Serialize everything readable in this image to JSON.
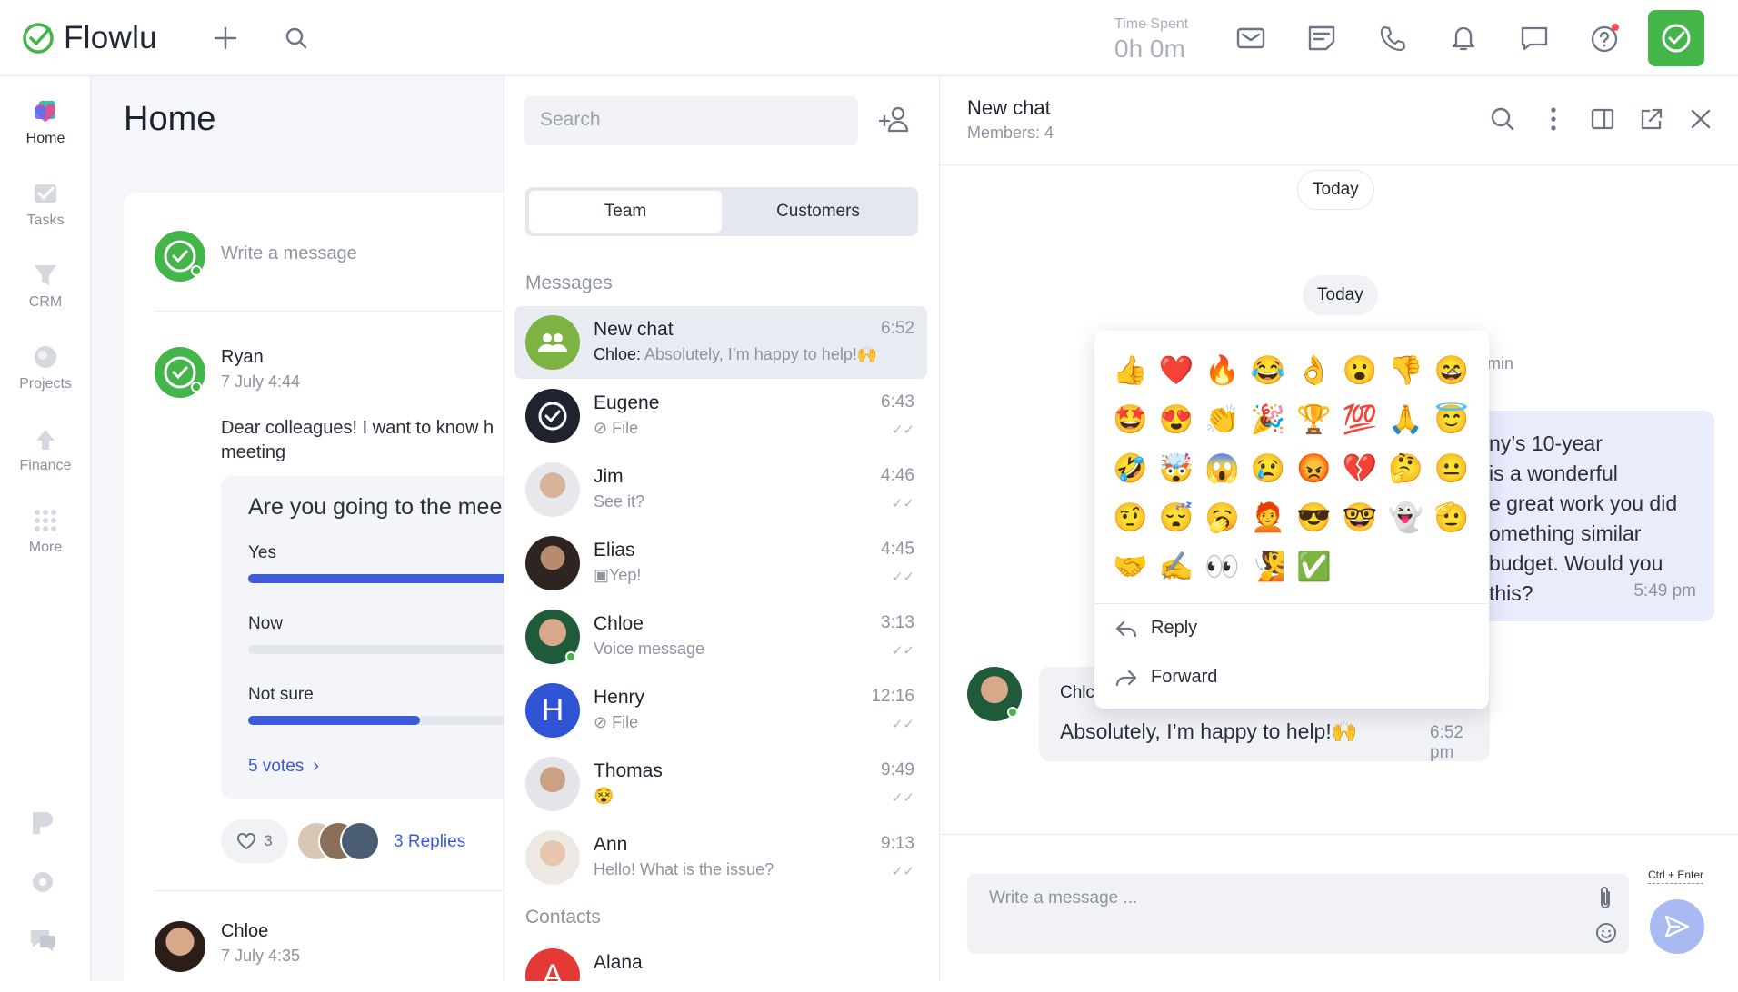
{
  "app": {
    "name": "Flowlu"
  },
  "topbar": {
    "time_label": "Time Spent",
    "time_value": "0h 0m"
  },
  "rail": {
    "items": [
      {
        "label": "Home",
        "icon": "home-icon"
      },
      {
        "label": "Tasks",
        "icon": "tasks-icon"
      },
      {
        "label": "CRM",
        "icon": "crm-icon"
      },
      {
        "label": "Projects",
        "icon": "projects-icon"
      },
      {
        "label": "Finance",
        "icon": "finance-icon"
      },
      {
        "label": "More",
        "icon": "more-grid-icon"
      }
    ]
  },
  "home": {
    "title": "Home",
    "write_placeholder": "Write a message",
    "post": {
      "author": "Ryan",
      "date": "7 July 4:44",
      "text_line1": "Dear colleagues! I want to know h",
      "text_line2": "meeting",
      "poll": {
        "question": "Are you going to the mee",
        "options": [
          {
            "label": "Yes",
            "fraction": 1.0
          },
          {
            "label": "Now",
            "fraction": 0.0
          },
          {
            "label": "Not sure",
            "fraction": 0.65
          }
        ],
        "votes": "5 votes"
      },
      "likes": "3",
      "replies": "3 Replies"
    },
    "post2": {
      "author": "Chloe",
      "date": "7 July 4:35"
    }
  },
  "chatlist": {
    "search_placeholder": "Search",
    "tabs": [
      "Team",
      "Customers"
    ],
    "messages_label": "Messages",
    "contacts_label": "Contacts",
    "chats": [
      {
        "name": "New chat",
        "time": "6:52",
        "sender": "Chloe:",
        "preview": " Absolutely, I’m happy to help!🙌"
      },
      {
        "name": "Eugene",
        "time": "6:43",
        "sender": "",
        "preview": "File"
      },
      {
        "name": "Jim",
        "time": "4:46",
        "sender": "",
        "preview": "See it?"
      },
      {
        "name": "Elias",
        "time": "4:45",
        "sender": "",
        "preview": "Yep!"
      },
      {
        "name": "Chloe",
        "time": "3:13",
        "sender": "",
        "preview": "Voice message"
      },
      {
        "name": "Henry",
        "time": "12:16",
        "sender": "",
        "preview": "File",
        "initial": "H"
      },
      {
        "name": "Thomas",
        "time": "9:49",
        "sender": "",
        "preview": "😵"
      },
      {
        "name": "Ann",
        "time": "9:13",
        "sender": "",
        "preview": "Hello! What is the issue?"
      }
    ],
    "contacts": [
      {
        "name": "Alana",
        "initial": "A"
      }
    ]
  },
  "conversation": {
    "title": "New chat",
    "members": "Members: 4",
    "date_pill_1": "Today",
    "date_pill_2": "Today",
    "partial_min": "min",
    "right_bubble": {
      "lines": [
        "ny’s 10-year",
        "is a wonderful",
        "e great work you did",
        "omething similar",
        "budget. Would you",
        "this?"
      ],
      "time": "5:49 pm"
    },
    "left_bubble": {
      "sender": "Chlc",
      "text": "Absolutely, I’m happy to help!🙌",
      "time": "6:52 pm"
    },
    "composer_placeholder": "Write a message ...",
    "shortcut_hint": "Ctrl + Enter"
  },
  "popup": {
    "emojis": [
      "👍",
      "❤️",
      "🔥",
      "😂",
      "👌",
      "😮",
      "👎",
      "😄",
      "🤩",
      "😍",
      "👏",
      "🎉",
      "🏆",
      "💯",
      "🙏",
      "😇",
      "🤣",
      "🤯",
      "😱",
      "😢",
      "😡",
      "💔",
      "🤔",
      "😐",
      "🤨",
      "😴",
      "🥱",
      "🧑‍🦰",
      "😎",
      "🤓",
      "👻",
      "🫡",
      "🤝",
      "✍️",
      "👀",
      "🧏",
      "✅"
    ],
    "reply": "Reply",
    "forward": "Forward"
  },
  "colors": {
    "brand_green": "#43b549",
    "accent_blue": "#3b5bdb",
    "send_blue": "#a9b9f1"
  }
}
